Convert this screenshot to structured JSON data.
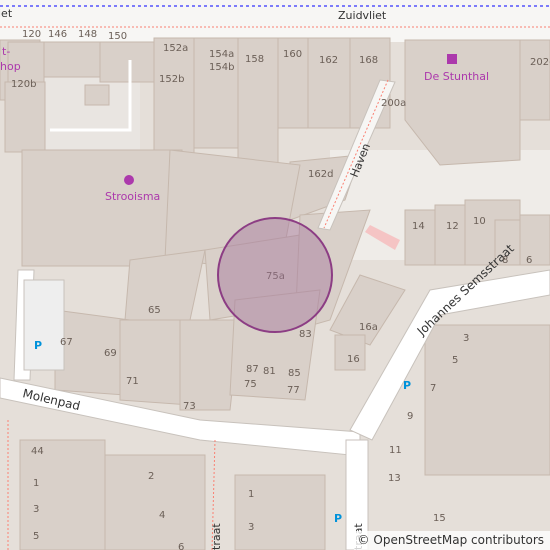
{
  "map": {
    "street_labels": {
      "zuidvliet": "Zuidvliet",
      "haven": "Haven",
      "molenpad": "Molenpad",
      "johannes_semsstraat": "Johannes Semsstraat",
      "straat_partial": "traat",
      "vliet_partial": "iet"
    },
    "pois": {
      "strooisma": "Strooisma",
      "de_stunthal": "De Stunthal",
      "shop_partial_1": "t-",
      "shop_partial_2": "hop"
    },
    "house_numbers": {
      "n120": "120",
      "n146": "146",
      "n148": "148",
      "n150": "150",
      "n152a": "152a",
      "n152b": "152b",
      "n154a": "154a",
      "n154b": "154b",
      "n158": "158",
      "n160": "160",
      "n162": "162",
      "n168": "168",
      "n120b": "120b",
      "n200a": "200a",
      "n202": "202-",
      "n162d": "162d",
      "n10": "10",
      "n14": "14",
      "n12": "12",
      "n8": "8",
      "n6": "6",
      "n75a": "75a",
      "n65": "65",
      "n83": "83",
      "n16a": "16a",
      "n16": "16",
      "n67": "67",
      "n69": "69",
      "n71": "71",
      "n73": "73",
      "n87": "87",
      "n81": "81",
      "n85": "85",
      "n75": "75",
      "n77": "77",
      "n3": "3",
      "n5": "5",
      "n7": "7",
      "n9": "9",
      "n11": "11",
      "n13": "13",
      "n15": "15",
      "n44": "44",
      "n2": "2",
      "n1a": "1",
      "n3a": "3",
      "n5a": "5",
      "n4": "4",
      "n1b": "1",
      "n3b": "3",
      "n6b": "6"
    },
    "parking_symbol": "P",
    "attribution": {
      "symbol": "©",
      "text": "OpenStreetMap contributors"
    },
    "colors": {
      "building": "#d9d0c9",
      "building_stroke": "#c6b8ad",
      "road": "#ffffff",
      "road_casing": "#c8c2bc",
      "land": "#e5dfd9",
      "landuse": "#f2efe9",
      "footway": "#fa8072",
      "shop_icon": "#ac39ac",
      "marker_fill": "#a5769b",
      "marker_stroke": "#8c3d84",
      "parking": "#0092da",
      "cycleway": "#0000ff",
      "water_pink": "#f5c4c4"
    }
  }
}
